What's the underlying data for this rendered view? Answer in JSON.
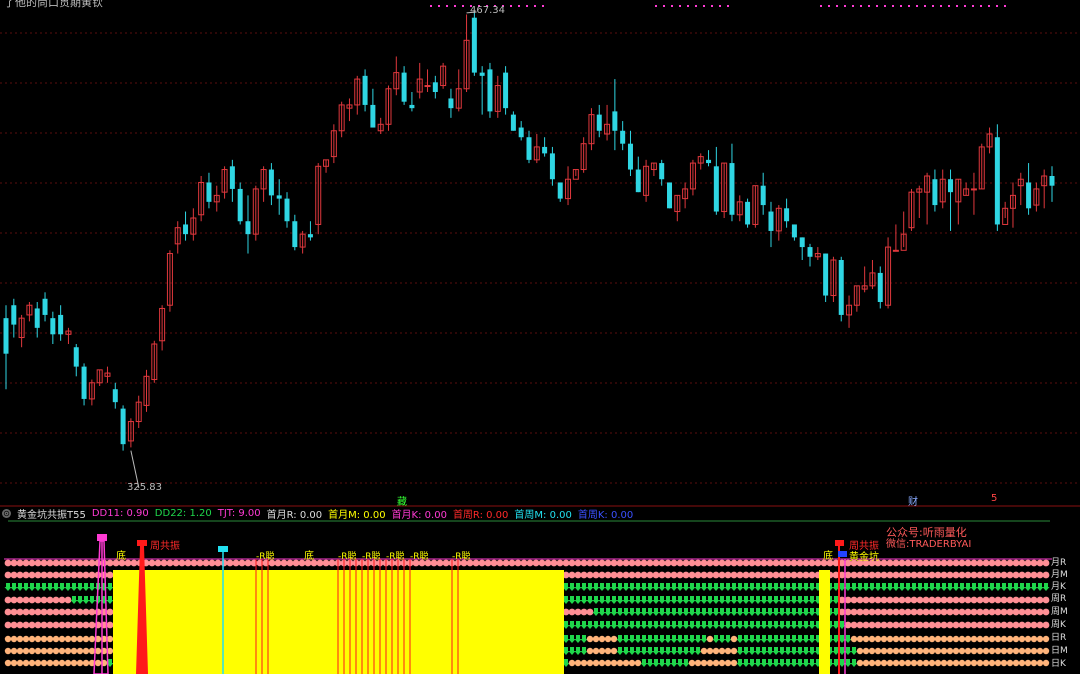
{
  "title": "了他的尚口贯期黄钦",
  "colors": {
    "up": "#e0383d",
    "down": "#2fd6e3",
    "grid": "#5a0e0e",
    "green": "#1fd64b",
    "pink": "#ff9fa3",
    "magenta": "#ff3bd4",
    "red": "#ff1a1a",
    "yellow": "#ffff00",
    "cyan": "#22e0f0"
  },
  "chart_data": {
    "type": "candlestick",
    "price_labels": {
      "high": "467.34",
      "low": "325.83"
    },
    "candles": [
      [
        372,
        361,
        376,
        350
      ],
      [
        376,
        370,
        378,
        366
      ],
      [
        366,
        372,
        373,
        363
      ],
      [
        373,
        376,
        377,
        371
      ],
      [
        375,
        369,
        377,
        366
      ],
      [
        378,
        373,
        380,
        371
      ],
      [
        372,
        367,
        374,
        364
      ],
      [
        373,
        367,
        376,
        365
      ],
      [
        367,
        368,
        369,
        364
      ],
      [
        363,
        357,
        364,
        354
      ],
      [
        357,
        347,
        358,
        345
      ],
      [
        347,
        352,
        353,
        345
      ],
      [
        352,
        356,
        356,
        351
      ],
      [
        354,
        355,
        357,
        352
      ],
      [
        350,
        346,
        352,
        344
      ],
      [
        344,
        333,
        345,
        331
      ],
      [
        334,
        340,
        341,
        332
      ],
      [
        340,
        346,
        348,
        338
      ],
      [
        345,
        354,
        356,
        343
      ],
      [
        353,
        364,
        365,
        352
      ],
      [
        365,
        375,
        376,
        362
      ],
      [
        376,
        392,
        393,
        374
      ],
      [
        395,
        400,
        402,
        392
      ],
      [
        401,
        398,
        405,
        396
      ],
      [
        398,
        403,
        406,
        396
      ],
      [
        404,
        414,
        416,
        402
      ],
      [
        414,
        408,
        417,
        406
      ],
      [
        408,
        410,
        413,
        405
      ],
      [
        411,
        418,
        419,
        409
      ],
      [
        419,
        412,
        421,
        408
      ],
      [
        412,
        402,
        414,
        401
      ],
      [
        402,
        398,
        410,
        392
      ],
      [
        398,
        412,
        413,
        396
      ],
      [
        412,
        418,
        419,
        408
      ],
      [
        418,
        410,
        420,
        407
      ],
      [
        410,
        409,
        415,
        404
      ],
      [
        409,
        402,
        411,
        400
      ],
      [
        402,
        394,
        404,
        393
      ],
      [
        394,
        398,
        399,
        392
      ],
      [
        398,
        397,
        402,
        396
      ],
      [
        401,
        419,
        420,
        398
      ],
      [
        419,
        421,
        421,
        417
      ],
      [
        422,
        430,
        432,
        420
      ],
      [
        430,
        438,
        439,
        428
      ],
      [
        437,
        438,
        440,
        433
      ],
      [
        438,
        446,
        447,
        435
      ],
      [
        447,
        438,
        449,
        436
      ],
      [
        438,
        431,
        443,
        431
      ],
      [
        430,
        432,
        434,
        429
      ],
      [
        432,
        443,
        444,
        430
      ],
      [
        443,
        448,
        453,
        441
      ],
      [
        448,
        439,
        450,
        438
      ],
      [
        438,
        437,
        442,
        436
      ],
      [
        442,
        446,
        451,
        440
      ],
      [
        444,
        444,
        449,
        442
      ],
      [
        445,
        442,
        447,
        440
      ],
      [
        444,
        450,
        451,
        443
      ],
      [
        440,
        437,
        443,
        434
      ],
      [
        437,
        443,
        449,
        436
      ],
      [
        443,
        458,
        466,
        442
      ],
      [
        465,
        448,
        467,
        447
      ],
      [
        448,
        447,
        450,
        435
      ],
      [
        449,
        436,
        451,
        434
      ],
      [
        436,
        444,
        447,
        434
      ],
      [
        448,
        437,
        450,
        435
      ],
      [
        435,
        430,
        436,
        430
      ],
      [
        431,
        428,
        433,
        427
      ],
      [
        428,
        421,
        430,
        420
      ],
      [
        421,
        425,
        429,
        420
      ],
      [
        425,
        423,
        428,
        422
      ],
      [
        423,
        415,
        425,
        413
      ],
      [
        414,
        409,
        414,
        408
      ],
      [
        409,
        415,
        419,
        407
      ],
      [
        415,
        418,
        418,
        416
      ],
      [
        418,
        426,
        428,
        417
      ],
      [
        426,
        435,
        437,
        424
      ],
      [
        435,
        430,
        438,
        428
      ],
      [
        429,
        432,
        438,
        427
      ],
      [
        436,
        430,
        446,
        424
      ],
      [
        430,
        426,
        433,
        424
      ],
      [
        426,
        418,
        430,
        416
      ],
      [
        418,
        411,
        422,
        411
      ],
      [
        410,
        419,
        421,
        408
      ],
      [
        418,
        420,
        420,
        416
      ],
      [
        420,
        415,
        421,
        413
      ],
      [
        414,
        406,
        414,
        406
      ],
      [
        405,
        410,
        410,
        402
      ],
      [
        409,
        412,
        414,
        406
      ],
      [
        412,
        420,
        421,
        410
      ],
      [
        420,
        422,
        423,
        418
      ],
      [
        421,
        420,
        424,
        419
      ],
      [
        419,
        405,
        425,
        404
      ],
      [
        405,
        420,
        420,
        403
      ],
      [
        420,
        404,
        426,
        402
      ],
      [
        404,
        408,
        410,
        402
      ],
      [
        408,
        401,
        409,
        400
      ],
      [
        401,
        413,
        413,
        400
      ],
      [
        413,
        407,
        417,
        404
      ],
      [
        405,
        399,
        408,
        394
      ],
      [
        399,
        406,
        407,
        396
      ],
      [
        406,
        402,
        409,
        400
      ],
      [
        401,
        397,
        401,
        396
      ],
      [
        397,
        394,
        397,
        390
      ],
      [
        394,
        391,
        395,
        388
      ],
      [
        391,
        392,
        394,
        390
      ],
      [
        392,
        379,
        392,
        377
      ],
      [
        379,
        390,
        391,
        377
      ],
      [
        390,
        373,
        391,
        371
      ],
      [
        373,
        376,
        379,
        369
      ],
      [
        376,
        382,
        382,
        374
      ],
      [
        381,
        382,
        388,
        380
      ],
      [
        382,
        386,
        390,
        381
      ],
      [
        386,
        377,
        388,
        375
      ],
      [
        376,
        394,
        397,
        375
      ],
      [
        393,
        393,
        401,
        393
      ],
      [
        393,
        398,
        405,
        394
      ],
      [
        400,
        411,
        412,
        399
      ],
      [
        411,
        412,
        413,
        403
      ],
      [
        411,
        416,
        417,
        401
      ],
      [
        415,
        407,
        418,
        405
      ],
      [
        408,
        415,
        418,
        406
      ],
      [
        415,
        411,
        418,
        399
      ],
      [
        408,
        415,
        415,
        401
      ],
      [
        410,
        412,
        414,
        410
      ],
      [
        412,
        412,
        417,
        404
      ],
      [
        412,
        425,
        426,
        412
      ],
      [
        425,
        429,
        431,
        423
      ],
      [
        428,
        401,
        432,
        399
      ],
      [
        401,
        406,
        408,
        403
      ],
      [
        406,
        410,
        414,
        400
      ],
      [
        413,
        415,
        417,
        407
      ],
      [
        414,
        406,
        420,
        404
      ],
      [
        407,
        412,
        414,
        405
      ],
      [
        413,
        416,
        418,
        406
      ],
      [
        416,
        413,
        419,
        408
      ]
    ]
  },
  "infobar": [
    {
      "t": "黄金坑共振T55",
      "c": "#dddddd"
    },
    {
      "t": "DD11: 0.90",
      "c": "#ff3bd4"
    },
    {
      "t": "DD22: 1.20",
      "c": "#1fd64b"
    },
    {
      "t": "TJT: 9.00",
      "c": "#ff3bd4"
    },
    {
      "t": "首月R: 0.00",
      "c": "#dddddd"
    },
    {
      "t": "首月M: 0.00",
      "c": "#ffff00"
    },
    {
      "t": "首月K: 0.00",
      "c": "#ff3bd4"
    },
    {
      "t": "首周R: 0.00",
      "c": "#ff2a2a"
    },
    {
      "t": "首周M: 0.00",
      "c": "#22e0f0"
    },
    {
      "t": "首周K: 0.00",
      "c": "#3a50ff"
    }
  ],
  "markers": {
    "zang": "藏",
    "cai": "财",
    "five": "5",
    "expand": "⊙"
  },
  "watermark": {
    "line1": "公众号:听雨量化",
    "line2": "微信:TRADERBYAI"
  },
  "signals": {
    "di1": "底",
    "di2": "底",
    "di3": "底",
    "zhouGongZhen1": "周共振",
    "zhouGongZhen2": "周共振",
    "huangJinKeng": "黄金坑",
    "xiaoluo": "-R聪"
  },
  "row_labels": [
    "月R",
    "月M",
    "月K",
    "周R",
    "周M",
    "周K",
    "日R",
    "日M",
    "日K"
  ]
}
